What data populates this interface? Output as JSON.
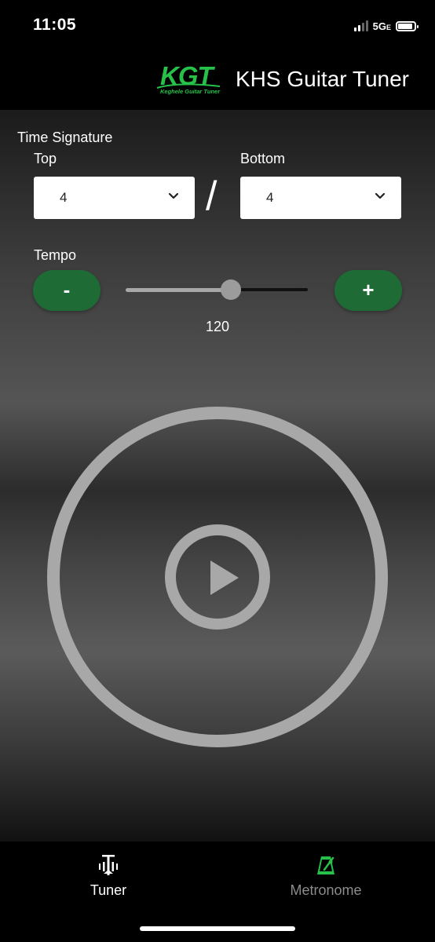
{
  "status_bar": {
    "time": "11:05",
    "network": "5G",
    "network_suffix": "E"
  },
  "header": {
    "logo_text": "KGT",
    "logo_subtext": "Keghele Guitar Tuner",
    "title": "KHS Guitar Tuner"
  },
  "time_signature": {
    "label": "Time Signature",
    "top": {
      "label": "Top",
      "value": "4"
    },
    "separator": "/",
    "bottom": {
      "label": "Bottom",
      "value": "4"
    }
  },
  "tempo": {
    "label": "Tempo",
    "decrease_label": "-",
    "increase_label": "+",
    "value": "120",
    "slider_fraction": 0.57
  },
  "tabs": [
    {
      "label": "Tuner",
      "icon": "tuning-fork-icon",
      "active": false
    },
    {
      "label": "Metronome",
      "icon": "metronome-icon",
      "active": true
    }
  ],
  "colors": {
    "accent_green": "#1e6b35",
    "logo_green": "#27c14a",
    "inactive_tab": "#8c8c8c",
    "circle_gray": "#a8a8a8"
  }
}
